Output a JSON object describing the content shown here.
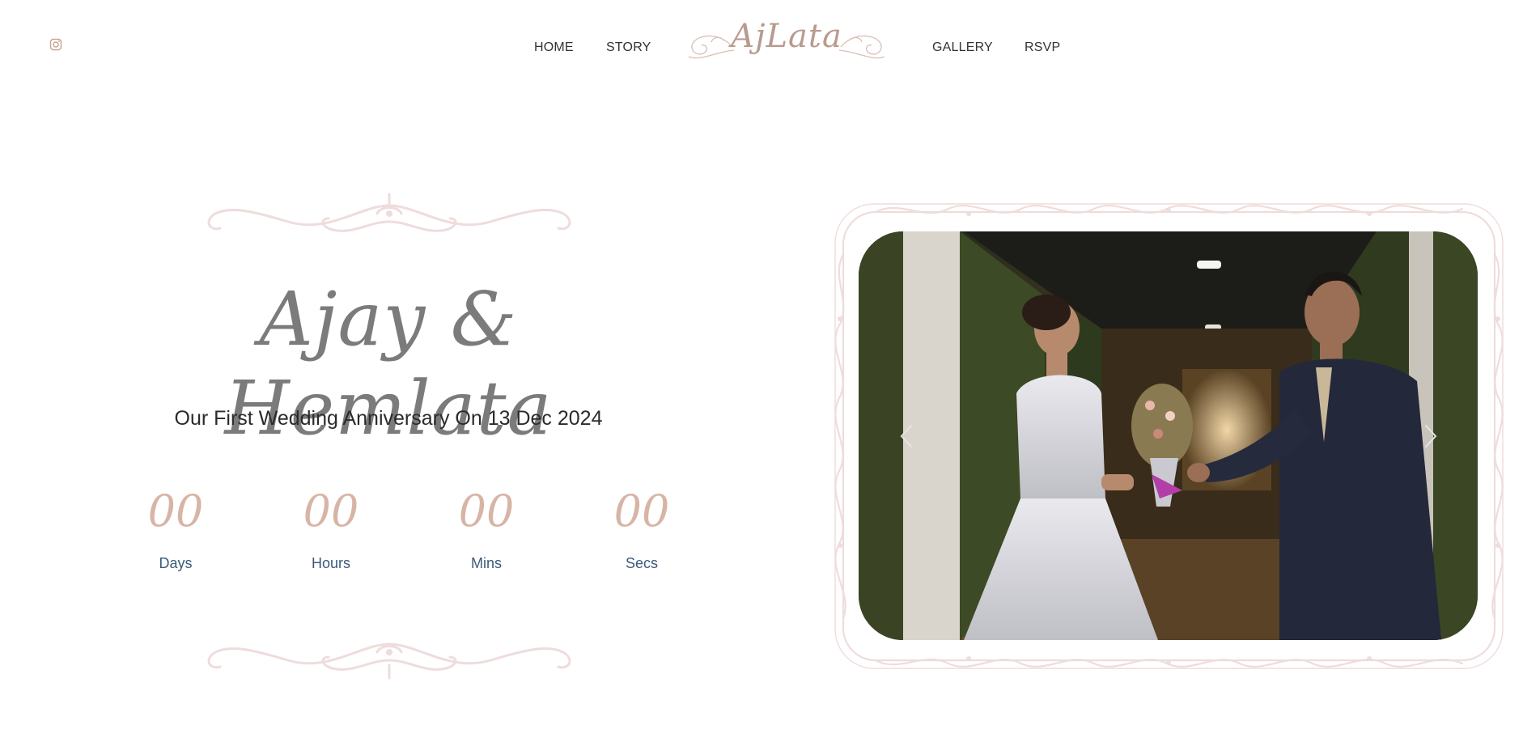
{
  "header": {
    "instagram_icon": "instagram-icon",
    "nav_left": [
      "HOME",
      "STORY"
    ],
    "logo_text": "AjLata",
    "nav_right": [
      "GALLERY",
      "RSVP"
    ]
  },
  "hero": {
    "couple_names": "Ajay & Hemlata",
    "subtitle": "Our First Wedding Anniversary On 13 Dec 2024",
    "countdown": [
      {
        "value": "00",
        "label": "Days"
      },
      {
        "value": "00",
        "label": "Hours"
      },
      {
        "value": "00",
        "label": "Mins"
      },
      {
        "value": "00",
        "label": "Secs"
      }
    ]
  },
  "slider": {
    "prev_icon": "chevron-left-icon",
    "next_icon": "chevron-right-icon"
  },
  "colors": {
    "accent": "#d7b5a6",
    "flourish": "#efdcdc",
    "label": "#3b5a7a",
    "names": "#7b7b7b"
  }
}
